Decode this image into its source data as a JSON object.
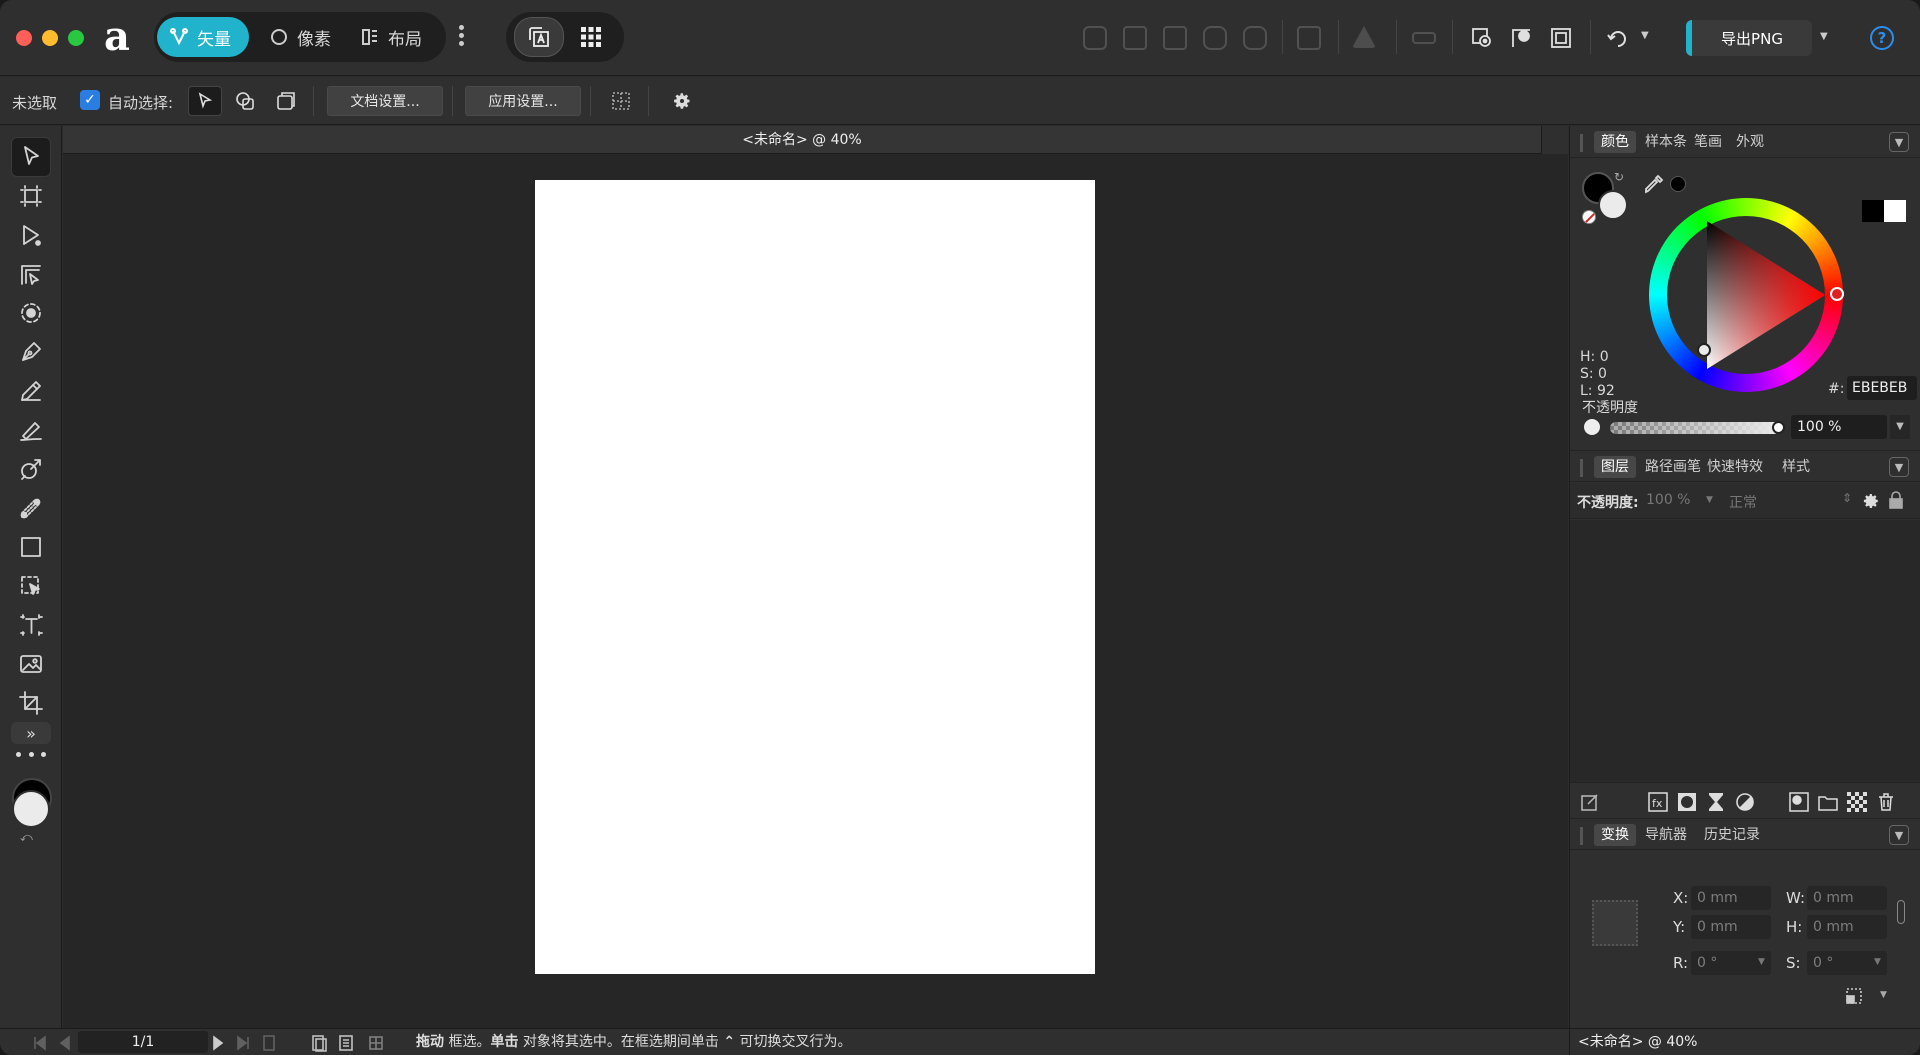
{
  "app": {
    "personas": [
      "矢量",
      "像素",
      "布局"
    ],
    "export_label": "导出PNG",
    "help_label": "?"
  },
  "context_toolbar": {
    "selection_status": "未选取",
    "auto_select_label": "自动选择:",
    "auto_select_checked": true,
    "doc_settings": "文档设置...",
    "app_settings": "应用设置..."
  },
  "document": {
    "tab_title": "<未命名> @ 40%",
    "page_color": "#ffffff"
  },
  "color_panel": {
    "tabs": [
      "颜色",
      "样本条",
      "笔画",
      "外观"
    ],
    "h": "H: 0",
    "s": "S: 0",
    "l": "L: 92",
    "hex_label": "#:",
    "hex_value": "EBEBEB",
    "opacity_label": "不透明度",
    "opacity_value": "100 %",
    "fill_color": "#EBEBEB",
    "stroke_color": "#000000"
  },
  "layers_panel": {
    "tabs": [
      "图层",
      "路径画笔",
      "快速特效",
      "样式"
    ],
    "opacity_label": "不透明度:",
    "opacity_value": "100 %",
    "blend_mode": "正常"
  },
  "transform_panel": {
    "tabs": [
      "变换",
      "导航器",
      "历史记录"
    ],
    "x_label": "X:",
    "x_value": "0 mm",
    "y_label": "Y:",
    "y_value": "0 mm",
    "w_label": "W:",
    "w_value": "0 mm",
    "h_label": "H:",
    "h_value": "0 mm",
    "r_label": "R:",
    "r_value": "0 °",
    "s_label": "S:",
    "s_value": "0 °"
  },
  "status_bar": {
    "page_indicator": "1/1",
    "hint_drag": "拖动",
    "hint_1": " 框选。",
    "hint_click": "单击",
    "hint_2": " 对象将其选中。在框选期间单击 ",
    "hint_key": "⌃",
    "hint_3": " 可切换交叉行为。",
    "doc_name": "<未命名> @ 40%"
  },
  "colors": {
    "accent": "#22b3cc",
    "checkbox": "#2a7de1",
    "help": "#2a8ef0"
  }
}
